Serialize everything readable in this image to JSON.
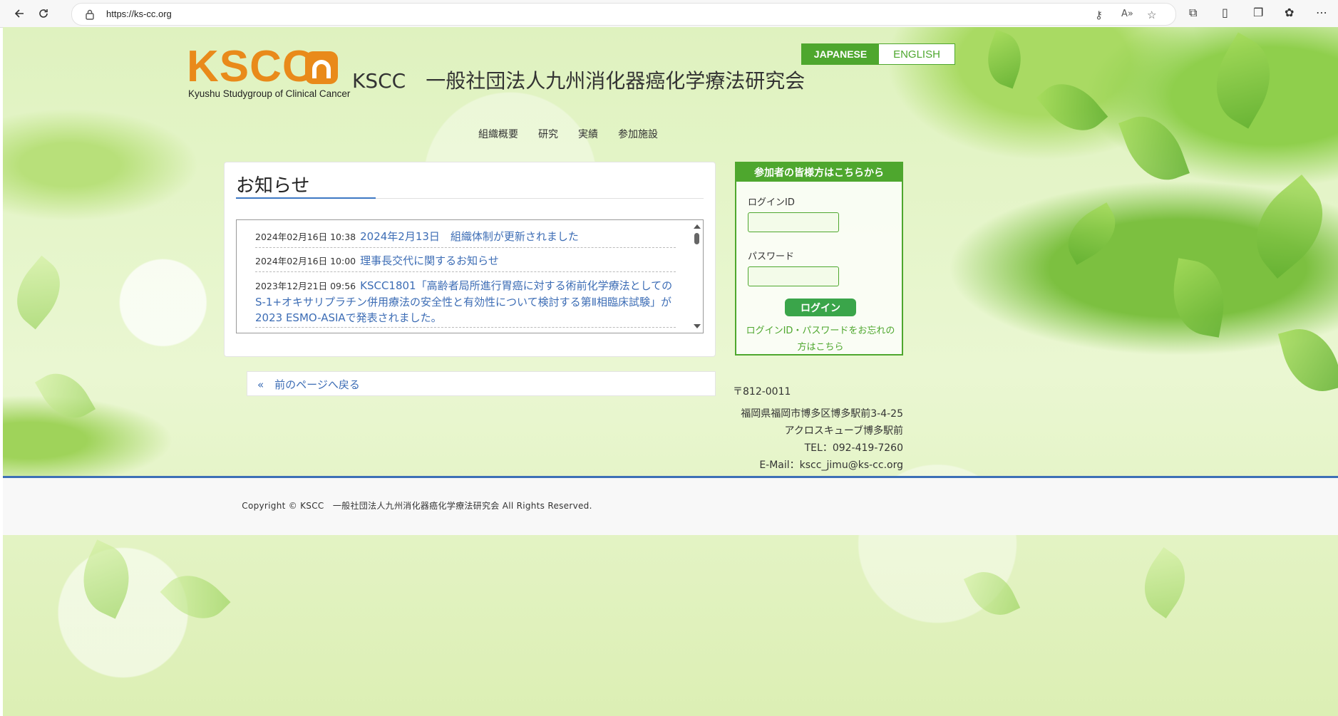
{
  "browser": {
    "url": "https://ks-cc.org",
    "icons": {
      "back": "back-arrow-icon",
      "reload": "reload-icon",
      "lock": "lock-icon"
    }
  },
  "header": {
    "logo_text": "KSCC",
    "logo_subtext": "Kyushu Studygroup of Clinical Cancer",
    "site_title": "KSCC　一般社団法人九州消化器癌化学療法研究会",
    "lang_japanese": "JAPANESE",
    "lang_english": "ENGLISH"
  },
  "nav": {
    "items": [
      {
        "label": "組織概要"
      },
      {
        "label": "研究"
      },
      {
        "label": "実績"
      },
      {
        "label": "参加施設"
      }
    ]
  },
  "news": {
    "title": "お知らせ",
    "items": [
      {
        "date": "2024年02月16日 10:38",
        "text": "2024年2月13日　組織体制が更新されました"
      },
      {
        "date": "2024年02月16日 10:00",
        "text": "理事長交代に関するお知らせ"
      },
      {
        "date": "2023年12月21日 09:56",
        "text": "KSCC1801「高齢者局所進行胃癌に対する術前化学療法としてのS-1+オキサリプラチン併用療法の安全性と有効性について検討する第Ⅱ相臨床試験」が2023 ESMO-ASIAで発表されました。"
      }
    ],
    "back_label": "«　前のページへ戻る"
  },
  "login": {
    "heading": "参加者の皆様方はこちらから",
    "id_label": "ログインID",
    "password_label": "パスワード",
    "button_label": "ログイン",
    "forgot_label": "ログインID・パスワードをお忘れの方はこちら"
  },
  "contact": {
    "postal": "〒812-0011",
    "address": "福岡県福岡市博多区博多駅前3-4-25",
    "building": "アクロスキューブ博多駅前",
    "tel": "TEL：092-419-7260",
    "email": "E-Mail：kscc_jimu@ks-cc.org"
  },
  "footer": {
    "copyright": "Copyright © KSCC　一般社団法人九州消化器癌化学療法研究会 All Rights Reserved."
  },
  "colors": {
    "accent_green": "#4ea72e",
    "link_blue": "#3d6db5",
    "logo_orange": "#e98a1a",
    "footer_rule": "#3d6fb6"
  }
}
